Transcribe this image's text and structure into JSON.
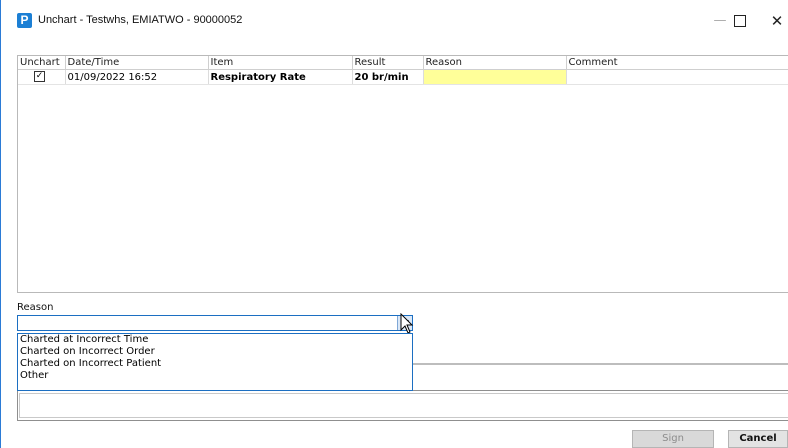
{
  "window": {
    "app_icon_letter": "P",
    "title": "Unchart - Testwhs, EMIATWO - 90000052",
    "minimize": "—",
    "close": "✕"
  },
  "grid": {
    "columns": [
      "Unchart",
      "Date/Time",
      "Item",
      "Result",
      "Reason",
      "Comment"
    ],
    "rows": [
      {
        "unchart_checked": true,
        "check_glyph": "✓",
        "datetime": "01/09/2022 16:52",
        "item": "Respiratory Rate",
        "result": "20 br/min",
        "reason": "",
        "comment": ""
      }
    ]
  },
  "reason": {
    "label": "Reason",
    "value": "",
    "options": [
      "Charted at Incorrect Time",
      "Charted on Incorrect Order",
      "Charted on Incorrect Patient",
      "Other"
    ]
  },
  "buttons": {
    "sign": "Sign",
    "cancel": "Cancel"
  },
  "colors": {
    "reason_highlight": "#ffff99",
    "accent": "#1c6fc2"
  }
}
